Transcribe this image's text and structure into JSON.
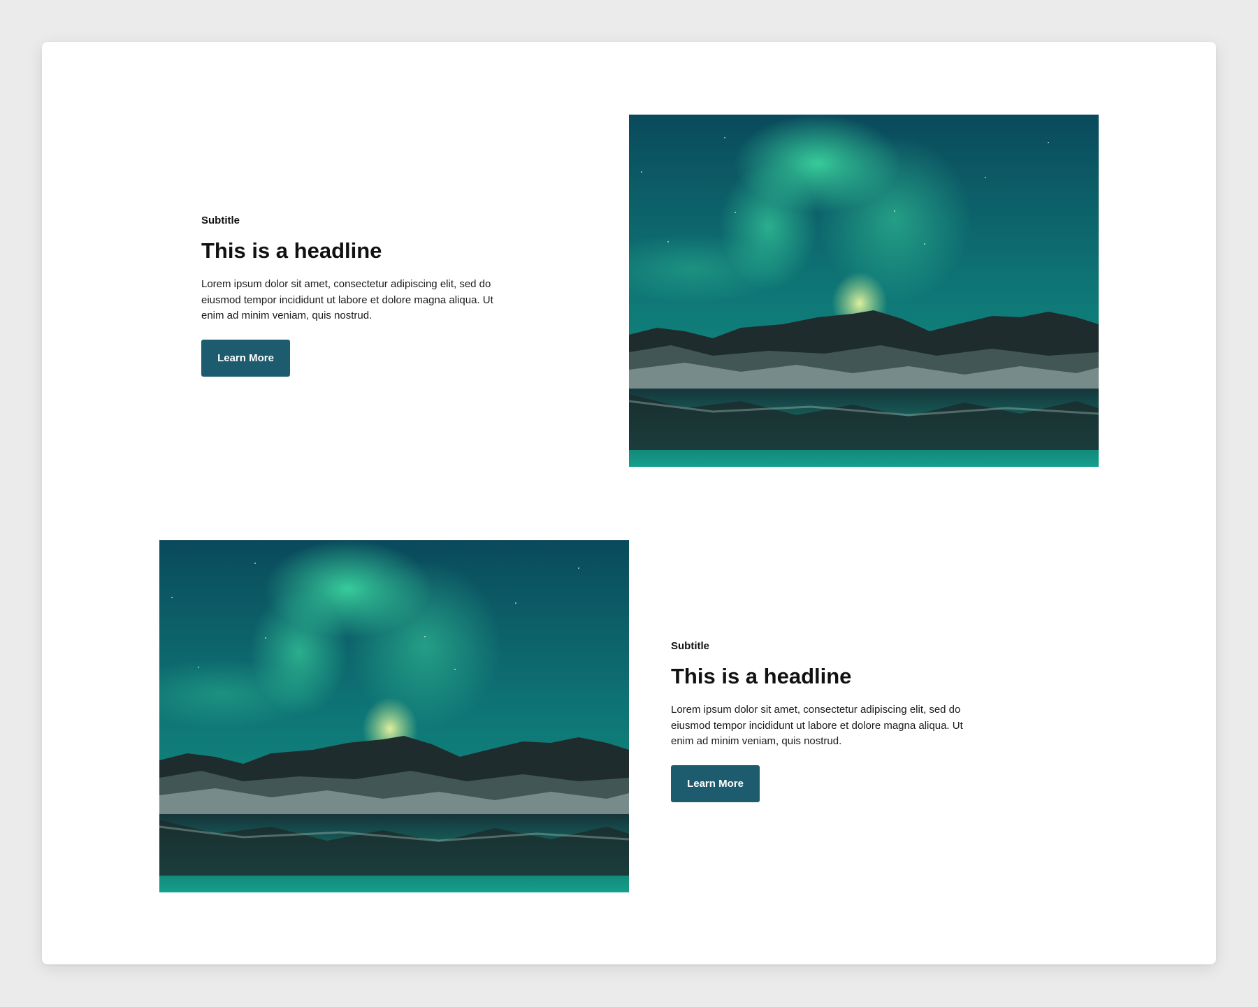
{
  "sections": [
    {
      "subtitle": "Subtitle",
      "headline": "This is a headline",
      "body": "Lorem ipsum dolor sit amet, consectetur adipiscing elit, sed do eiusmod tempor incididunt ut labore et dolore magna aliqua. Ut enim ad minim veniam, quis nostrud.",
      "button_label": "Learn More",
      "image_side": "right"
    },
    {
      "subtitle": "Subtitle",
      "headline": "This is a headline",
      "body": "Lorem ipsum dolor sit amet, consectetur adipiscing elit, sed do eiusmod tempor incididunt ut labore et dolore magna aliqua. Ut enim ad minim veniam, quis nostrud.",
      "button_label": "Learn More",
      "image_side": "left"
    }
  ],
  "colors": {
    "page_background": "#ebebeb",
    "card_background": "#ffffff",
    "button_background": "#1d5b6e",
    "button_text": "#ffffff",
    "heading_text": "#111111"
  },
  "images": {
    "subject": "aurora-over-mountains-photo"
  }
}
